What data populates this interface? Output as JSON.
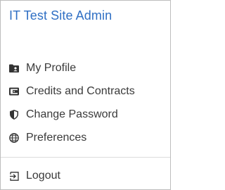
{
  "header": {
    "title": "IT Test Site Admin"
  },
  "menu": {
    "items": [
      {
        "label": "My Profile",
        "icon": "folder-user-icon"
      },
      {
        "label": "Credits and Contracts",
        "icon": "wallet-icon"
      },
      {
        "label": "Change Password",
        "icon": "shield-icon"
      },
      {
        "label": "Preferences",
        "icon": "globe-icon"
      }
    ],
    "logout": {
      "label": "Logout",
      "icon": "logout-icon"
    }
  },
  "colors": {
    "title": "#2f6fc4",
    "text": "#3a3a3a",
    "icon": "#333333",
    "border": "#bdbdbd"
  }
}
